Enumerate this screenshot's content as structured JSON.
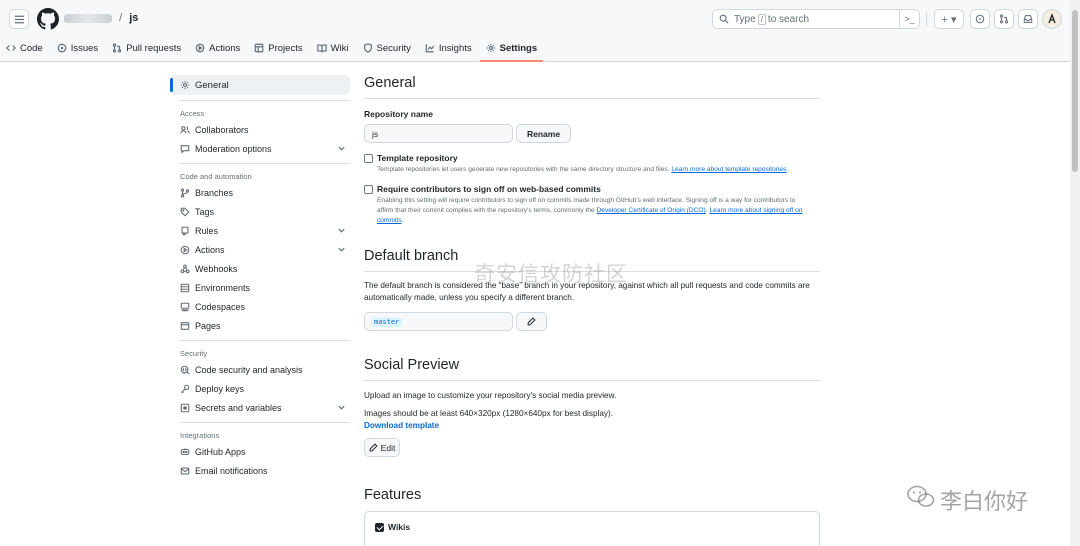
{
  "header": {
    "separator": "/",
    "repo": "js",
    "search_prefix": "Type",
    "search_key": "/",
    "search_suffix": "to search",
    "cmd_label": ">_",
    "plus_label": "+ ▾"
  },
  "tabs": [
    {
      "label": "Code",
      "icon": "code-icon"
    },
    {
      "label": "Issues",
      "icon": "issue-icon"
    },
    {
      "label": "Pull requests",
      "icon": "pull-request-icon"
    },
    {
      "label": "Actions",
      "icon": "play-icon"
    },
    {
      "label": "Projects",
      "icon": "table-icon"
    },
    {
      "label": "Wiki",
      "icon": "book-icon"
    },
    {
      "label": "Security",
      "icon": "shield-icon"
    },
    {
      "label": "Insights",
      "icon": "graph-icon"
    },
    {
      "label": "Settings",
      "icon": "gear-icon",
      "selected": true
    }
  ],
  "sidebar": {
    "active": "General",
    "groups": {
      "access": "Access",
      "code": "Code and automation",
      "security": "Security",
      "integrations": "Integrations"
    },
    "items": {
      "collaborators": "Collaborators",
      "moderation": "Moderation options",
      "branches": "Branches",
      "tags": "Tags",
      "rules": "Rules",
      "actions": "Actions",
      "webhooks": "Webhooks",
      "environments": "Environments",
      "codespaces": "Codespaces",
      "pages": "Pages",
      "code_security": "Code security and analysis",
      "deploy_keys": "Deploy keys",
      "secrets": "Secrets and variables",
      "github_apps": "GitHub Apps",
      "email": "Email notifications"
    }
  },
  "general": {
    "title": "General",
    "repo_name_label": "Repository name",
    "repo_name_value": "js",
    "rename_label": "Rename",
    "template": {
      "title": "Template repository",
      "desc": "Template repositories let users generate new repositories with the same directory structure and files.",
      "link": "Learn more about template repositories",
      "tail": ".",
      "checked": false
    },
    "signoff": {
      "title": "Require contributors to sign off on web-based commits",
      "desc": "Enabling this setting will require contributors to sign off on commits made through GitHub's web interface. Signing off is a way for contributors to affirm that their commit complies with the repository's terms, commonly the",
      "link1": "Developer Certificate of Origin (DCO)",
      "mid": ".",
      "link2": "Learn more about signing off on commits",
      "tail": ".",
      "checked": false
    }
  },
  "default_branch": {
    "title": "Default branch",
    "desc": "The default branch is considered the “base” branch in your repository, against which all pull requests and code commits are automatically made, unless you specify a different branch.",
    "branch": "master"
  },
  "social": {
    "title": "Social Preview",
    "desc1": "Upload an image to customize your repository's social media preview.",
    "desc2": "Images should be at least 640×320px (1280×640px for best display).",
    "download": "Download template",
    "edit": "Edit"
  },
  "features": {
    "title": "Features",
    "wikis_label": "Wikis",
    "wikis_checked": true
  },
  "watermarks": {
    "center": "奇安信攻防社区",
    "corner": "李白你好"
  }
}
